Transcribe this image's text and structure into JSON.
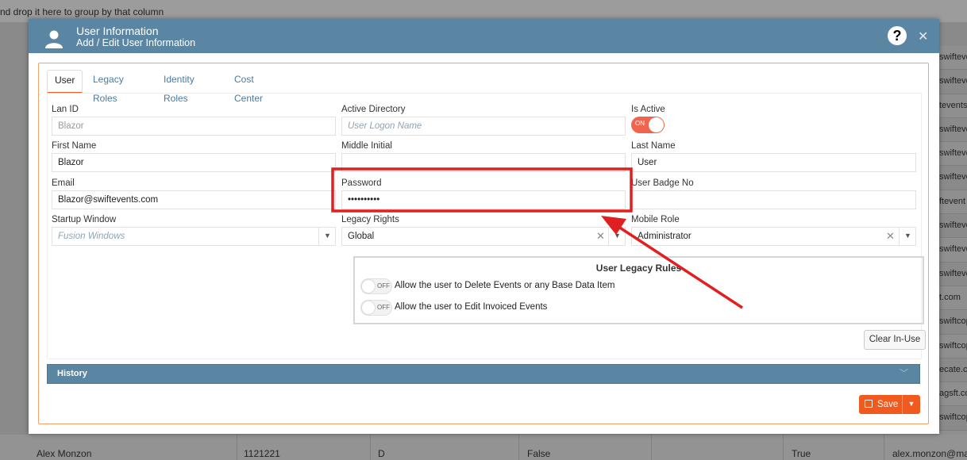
{
  "background": {
    "group_hint": "nd drop it here to group by that column",
    "right_column": [
      "swifteve",
      "swiftever",
      "tevents",
      "swifteve",
      "swiftever",
      "swifteve",
      "ftevent",
      "swiftever",
      "swiftever",
      "swiftever",
      "t.com",
      "swiftcop",
      "swiftcop",
      "ecate.c",
      "agsft.co",
      "swiftcop",
      "swiftcopy"
    ],
    "bottom_row": {
      "name": "Alex Monzon",
      "id": "1121221",
      "initial": "D",
      "flag": "False",
      "active": "True",
      "email": "alex.monzon@mai"
    }
  },
  "header": {
    "title": "User Information",
    "subtitle": "Add / Edit User Information"
  },
  "tabs": [
    {
      "label": "User",
      "active": true
    },
    {
      "label": "Legacy Roles",
      "active": false
    },
    {
      "label": "Identity Roles",
      "active": false
    },
    {
      "label": "Cost Center",
      "active": false
    }
  ],
  "form": {
    "lan_id": {
      "label": "Lan ID",
      "value": "Blazor"
    },
    "active_directory": {
      "label": "Active Directory",
      "placeholder": "User Logon Name"
    },
    "is_active": {
      "label": "Is Active",
      "state": "ON"
    },
    "first_name": {
      "label": "First Name",
      "value": "Blazor"
    },
    "middle_initial": {
      "label": "Middle Initial",
      "value": ""
    },
    "last_name": {
      "label": "Last Name",
      "value": "User"
    },
    "email": {
      "label": "Email",
      "value": "Blazor@swiftevents.com"
    },
    "password": {
      "label": "Password",
      "value": "••••••••••"
    },
    "user_badge_no": {
      "label": "User Badge No",
      "value": ""
    },
    "startup_window": {
      "label": "Startup Window",
      "placeholder": "Fusion Windows"
    },
    "legacy_rights": {
      "label": "Legacy Rights",
      "value": "Global"
    },
    "mobile_role": {
      "label": "Mobile Role",
      "value": "Administrator"
    }
  },
  "legacy_rules": {
    "title": "User Legacy Rules",
    "rules": [
      {
        "state": "OFF",
        "text": "Allow the user to Delete Events or any Base Data Item"
      },
      {
        "state": "OFF",
        "text": "Allow the user to Edit Invoiced Events"
      }
    ]
  },
  "buttons": {
    "clear_in_use": "Clear In-Use",
    "save": "Save"
  },
  "history_label": "History",
  "colors": {
    "header": "#5b86a3",
    "accent": "#f15a24",
    "annotation": "#e02020"
  }
}
